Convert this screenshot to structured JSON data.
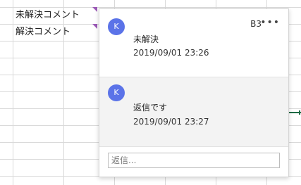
{
  "sheet": {
    "cells": [
      {
        "text": "未解決コメント"
      },
      {
        "text": "解決コメント"
      }
    ]
  },
  "comment_panel": {
    "cell_ref": "B3",
    "more_label": "•••",
    "first": {
      "avatar_initial": "K",
      "text": "未解決",
      "timestamp": "2019/09/01 23:26"
    },
    "reply": {
      "avatar_initial": "K",
      "text": "返信です",
      "timestamp": "2019/09/01 23:27"
    },
    "reply_input": {
      "placeholder": "返信...",
      "value": ""
    }
  },
  "colors": {
    "avatar": "#5b73e8",
    "comment_flag": "#9b59b6",
    "active_cell_border": "#1e6b45"
  }
}
